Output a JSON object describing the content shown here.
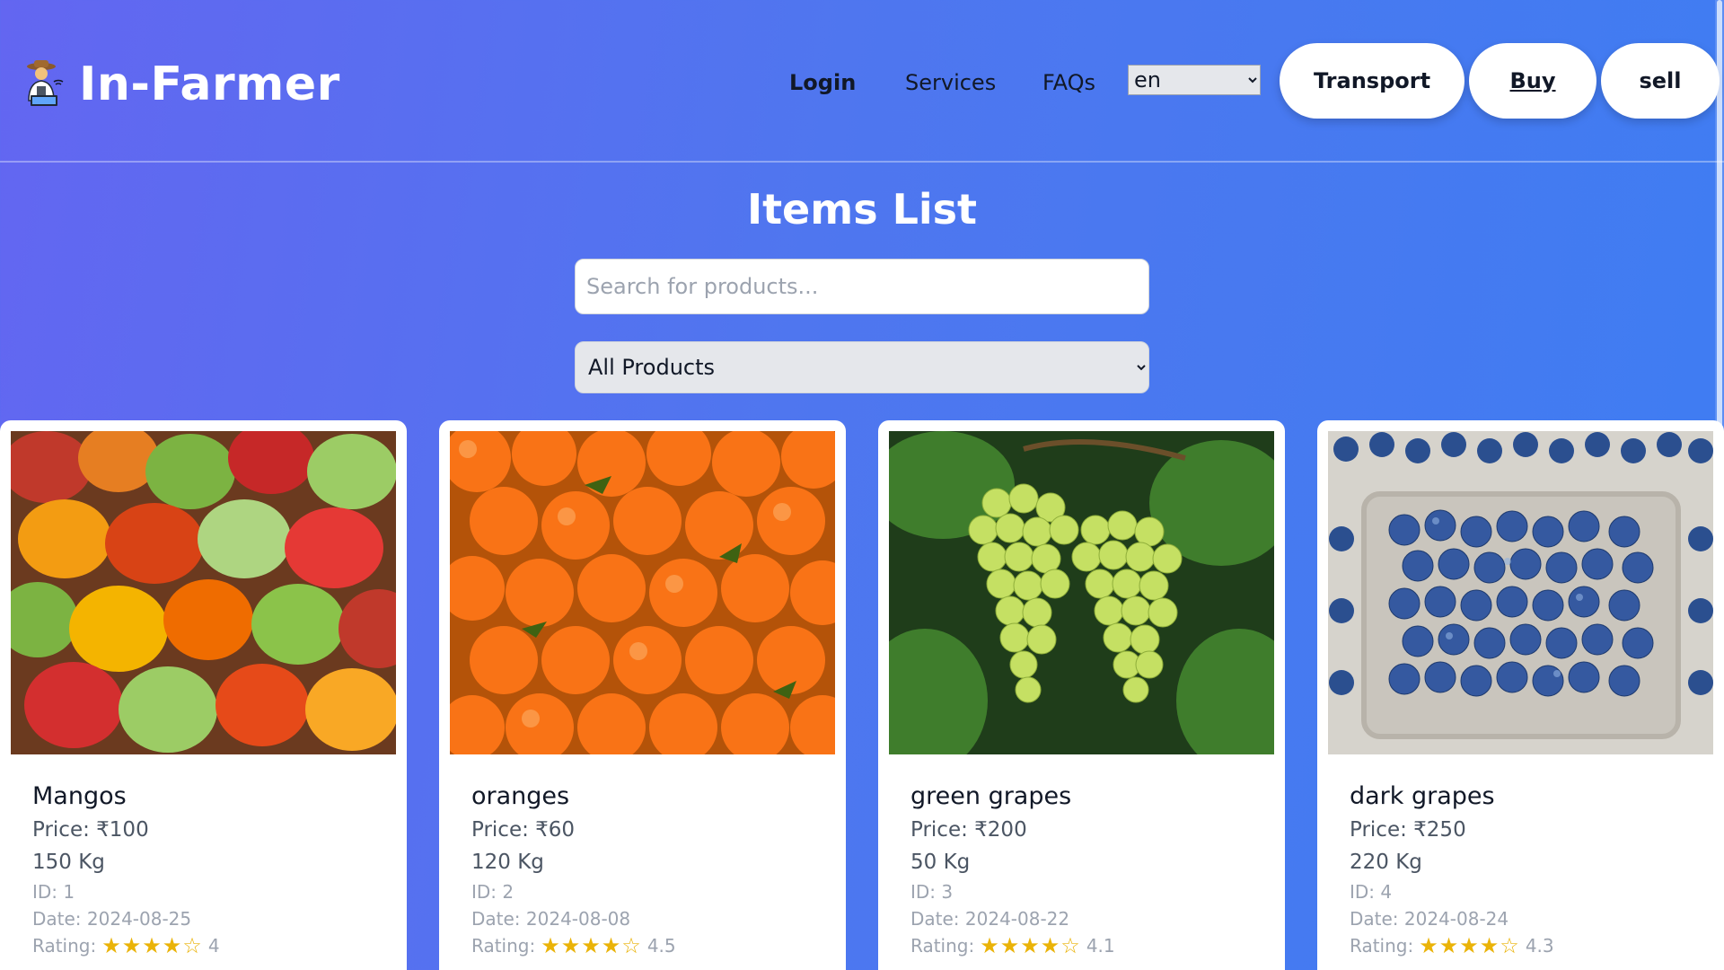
{
  "header": {
    "logo_text": "In-Farmer",
    "nav": {
      "login": "Login",
      "services": "Services",
      "faqs": "FAQs"
    },
    "language": {
      "selected": "en"
    },
    "buttons": {
      "transport": "Transport",
      "buy": "Buy",
      "sell": "sell"
    }
  },
  "main": {
    "title": "Items List",
    "search": {
      "placeholder": "Search for products..."
    },
    "category": {
      "selected": "All Products"
    },
    "items": [
      {
        "name": "Mangos",
        "price": "Price: ₹100",
        "quantity": "150 Kg",
        "id": "ID: 1",
        "date": "Date: 2024-08-25",
        "rating_label": "Rating:",
        "stars": "★★★★☆",
        "rating": "4"
      },
      {
        "name": "oranges",
        "price": "Price: ₹60",
        "quantity": "120 Kg",
        "id": "ID: 2",
        "date": "Date: 2024-08-08",
        "rating_label": "Rating:",
        "stars": "★★★★☆",
        "rating": "4.5"
      },
      {
        "name": "green grapes",
        "price": "Price: ₹200",
        "quantity": "50 Kg",
        "id": "ID: 3",
        "date": "Date: 2024-08-22",
        "rating_label": "Rating:",
        "stars": "★★★★☆",
        "rating": "4.1"
      },
      {
        "name": "dark grapes",
        "price": "Price: ₹250",
        "quantity": "220 Kg",
        "id": "ID: 4",
        "date": "Date: 2024-08-24",
        "rating_label": "Rating:",
        "stars": "★★★★☆",
        "rating": "4.3"
      }
    ]
  },
  "colors": {
    "star": "#eab308",
    "card_bg": "#ffffff",
    "title": "#ffffff"
  },
  "icons": {
    "logo": "farmer-laptop-icon",
    "dropdown": "chevron-down-icon"
  }
}
